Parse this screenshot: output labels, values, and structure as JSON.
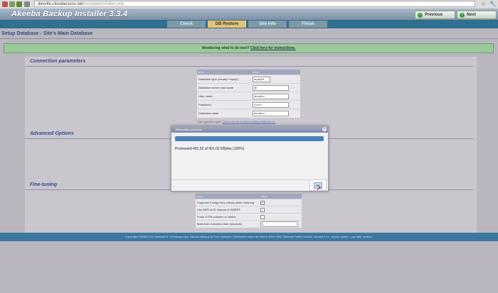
{
  "browser": {
    "url_host": "devsite.cloudaccess.net",
    "url_path": "/installation/index.php",
    "star": "☆",
    "wrench": "🔧"
  },
  "header": {
    "title": "Akeeba Backup Installer 3.3.4",
    "previous_label": "Previous",
    "previous_icon": "‹",
    "next_label": "Next",
    "next_icon": "›"
  },
  "tabs": [
    {
      "label": "Check",
      "active": false
    },
    {
      "label": "DB Restore",
      "active": true
    },
    {
      "label": "Site Info",
      "active": false
    },
    {
      "label": "Finish",
      "active": false
    }
  ],
  "page_title": "Setup Database - Site's Main Database",
  "notice": {
    "text": "Wondering what to do next?",
    "link": "Click here for instructions."
  },
  "sections": {
    "connection": "Connection parameters",
    "advanced": "Advanced Options",
    "finetuning": "Fine-tuning"
  },
  "connection_table": {
    "header_item": "Item",
    "header_value": "Value",
    "rows": [
      {
        "label": "Database type (usually \"mysql\")",
        "value": "mysqli"
      },
      {
        "label": "Database server host name",
        "value": "db"
      },
      {
        "label": "User name",
        "value": "devsiteo"
      },
      {
        "label": "Password",
        "value": "••••••••"
      },
      {
        "label": "Database name",
        "value": "devsiteo"
      }
    ],
    "help_text": "Can't get this right?",
    "help_link": "Click here for troubleshooting instructions."
  },
  "finetune_table": {
    "header_item": "Item",
    "header_value": "Value",
    "rows": [
      {
        "label": "Suppress Foreign Key checks while restoring",
        "checked": "✔"
      },
      {
        "label": "Use REPLACE instead of INSERT",
        "checked": ""
      },
      {
        "label": "Force UTF8 collation on tables",
        "checked": ""
      },
      {
        "label": "Maximum execution time (seconds)",
        "value": "5"
      }
    ]
  },
  "dialog": {
    "title": "Restoration progress",
    "close": "×",
    "progress": 1.0,
    "message": "Processed 401.02 of 401.02 KBytes (100%)",
    "ok_label": "OK"
  },
  "footer": "Copyright ©2006-2011 Nicholas K. Dionysopoulos. Akeeba Backup is Free Software. Distributed under the terms of the GNU General Public License, version 3 or - at your option - any later version.",
  "colors": {
    "header": "#7d8fa6",
    "tabs_bar": "#2f6f8f",
    "active_tab": "#e3c476",
    "notice": "#9bc99b",
    "progress": "#4b80b4"
  }
}
